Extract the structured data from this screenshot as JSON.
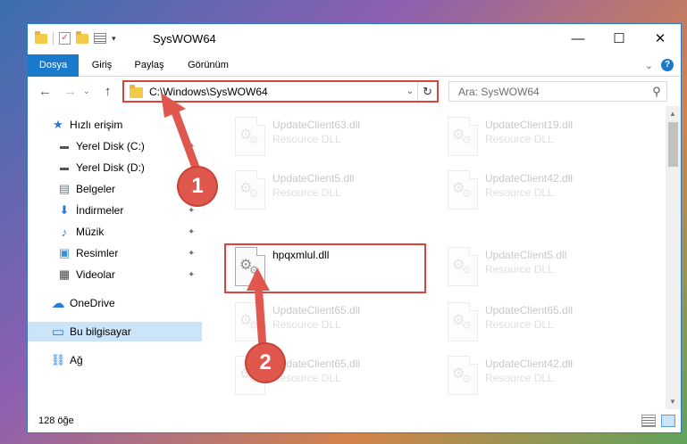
{
  "window": {
    "title": "SysWOW64",
    "minimize_glyph": "—",
    "maximize_glyph": "☐",
    "close_glyph": "✕"
  },
  "qat": {
    "check_glyph": "✓",
    "dropdown_glyph": "▾"
  },
  "ribbon": {
    "tabs": [
      "Dosya",
      "Giriş",
      "Paylaş",
      "Görünüm"
    ],
    "expand_glyph": "⌄",
    "help_glyph": "?"
  },
  "nav": {
    "back_glyph": "←",
    "forward_glyph": "→",
    "recent_glyph": "⌄",
    "up_glyph": "↑",
    "address": "C:\\Windows\\SysWOW64",
    "address_dropdown_glyph": "⌄",
    "refresh_glyph": "↻",
    "search_placeholder": "Ara: SysWOW64",
    "search_glyph": "⚲"
  },
  "sidebar": {
    "items": [
      {
        "label": "Hızlı erişim",
        "icon": "star-icon",
        "glyph": "★"
      },
      {
        "label": "Yerel Disk (C:)",
        "icon": "drive-icon",
        "glyph": "▬"
      },
      {
        "label": "Yerel Disk (D:)",
        "icon": "drive-icon",
        "glyph": "▬"
      },
      {
        "label": "Belgeler",
        "icon": "document-icon",
        "glyph": "▤"
      },
      {
        "label": "İndirmeler",
        "icon": "download-icon",
        "glyph": "⬇"
      },
      {
        "label": "Müzik",
        "icon": "music-icon",
        "glyph": "♪"
      },
      {
        "label": "Resimler",
        "icon": "pictures-icon",
        "glyph": "▣"
      },
      {
        "label": "Videolar",
        "icon": "video-icon",
        "glyph": "▦"
      },
      {
        "label": "OneDrive",
        "icon": "cloud-icon",
        "glyph": "☁"
      },
      {
        "label": "Bu bilgisayar",
        "icon": "computer-icon",
        "glyph": "▭"
      },
      {
        "label": "Ağ",
        "icon": "network-icon",
        "glyph": "⛓"
      }
    ],
    "pin_glyph": "📌"
  },
  "files": [
    {
      "name": "UpdateClient63.dll",
      "type": "Resource DLL"
    },
    {
      "name": "UpdateClient19.dll",
      "type": "Resource DLL"
    },
    {
      "name": "UpdateClient5.dll",
      "type": "Resource DLL"
    },
    {
      "name": "UpdateClient42.dll",
      "type": "Resource DLL"
    },
    {
      "name": "hpqxmlul.dll",
      "type": ""
    },
    {
      "name": "UpdateClient5.dll",
      "type": "Resource DLL"
    },
    {
      "name": "UpdateClient65.dll",
      "type": "Resource DLL"
    },
    {
      "name": "UpdateClient65.dll",
      "type": "Resource DLL"
    },
    {
      "name": "UpdateClient65.dll",
      "type": "Resource DLL"
    },
    {
      "name": "UpdateClient42.dll",
      "type": "Resource DLL"
    }
  ],
  "status": {
    "item_count": "128 öğe"
  },
  "annotations": {
    "step1": "1",
    "step2": "2",
    "accent_color": "#e0574d"
  }
}
